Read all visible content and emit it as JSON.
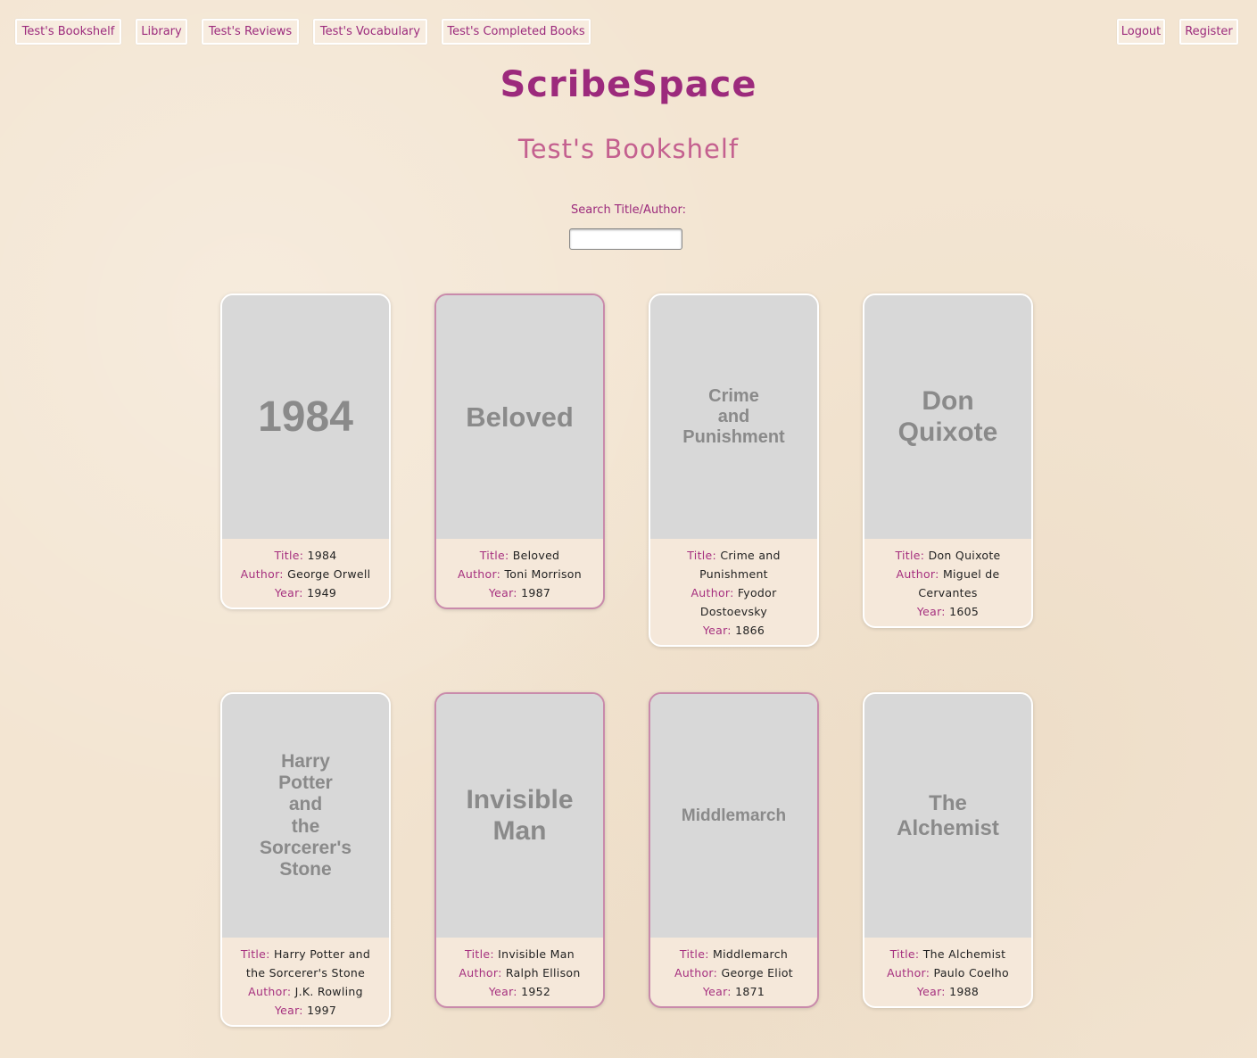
{
  "nav": {
    "bookshelf": "Test's Bookshelf",
    "library": "Library",
    "reviews": "Test's Reviews",
    "vocabulary": "Test's Vocabulary",
    "completed": "Test's Completed Books",
    "logout": "Logout",
    "register": "Register"
  },
  "site_title": "ScribeSpace",
  "page_title": "Test's Bookshelf",
  "search": {
    "label": "Search Title/Author:",
    "value": ""
  },
  "labels": {
    "title": "Title:",
    "author": "Author:",
    "year": "Year:"
  },
  "books": [
    {
      "cover": "1984",
      "title": "1984",
      "author": "George Orwell",
      "year": "1949"
    },
    {
      "cover": "Beloved",
      "title": "Beloved",
      "author": "Toni Morrison",
      "year": "1987"
    },
    {
      "cover": "Crime and Punishment",
      "title": "Crime and Punishment",
      "author": "Fyodor Dostoevsky",
      "year": "1866"
    },
    {
      "cover": "Don Quixote",
      "title": "Don Quixote",
      "author": "Miguel de Cervantes",
      "year": "1605"
    },
    {
      "cover": "Harry Potter and the Sorcerer's Stone",
      "title": "Harry Potter and the Sorcerer's Stone",
      "author": "J.K. Rowling",
      "year": "1997"
    },
    {
      "cover": "Invisible Man",
      "title": "Invisible Man",
      "author": "Ralph Ellison",
      "year": "1952"
    },
    {
      "cover": "Middlemarch",
      "title": "Middlemarch",
      "author": "George Eliot",
      "year": "1871"
    },
    {
      "cover": "The Alchemist",
      "title": "The Alchemist",
      "author": "Paulo Coelho",
      "year": "1988"
    }
  ]
}
